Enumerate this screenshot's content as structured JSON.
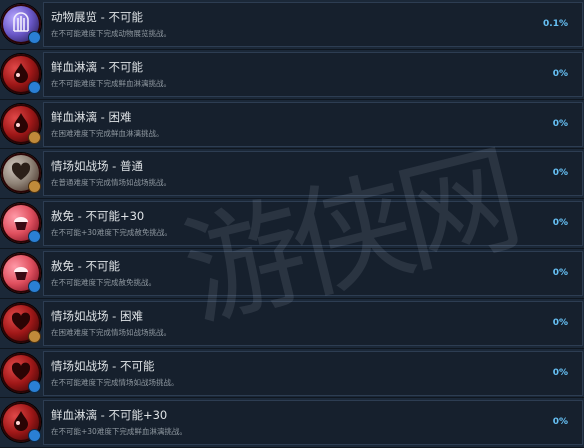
{
  "achievements": [
    {
      "title": "动物展览 - 不可能",
      "desc": "在不可能难度下完成动物展览挑战。",
      "pct": "0.1%",
      "icon": "cage-icon",
      "color": "purple"
    },
    {
      "title": "鲜血淋漓 - 不可能",
      "desc": "在不可能难度下完成鲜血淋漓挑战。",
      "pct": "0%",
      "icon": "blood-icon",
      "color": "red"
    },
    {
      "title": "鲜血淋漓 - 困难",
      "desc": "在困难难度下完成鲜血淋漓挑战。",
      "pct": "0%",
      "icon": "blood-icon",
      "color": "red"
    },
    {
      "title": "情场如战场 - 普通",
      "desc": "在普通难度下完成情场如战场挑战。",
      "pct": "0%",
      "icon": "heart-icon",
      "color": "gray"
    },
    {
      "title": "赦免 - 不可能+30",
      "desc": "在不可能+30难度下完成赦免挑战。",
      "pct": "0%",
      "icon": "cupcake-icon",
      "color": "pink"
    },
    {
      "title": "赦免 - 不可能",
      "desc": "在不可能难度下完成赦免挑战。",
      "pct": "0%",
      "icon": "cupcake-icon",
      "color": "pink"
    },
    {
      "title": "情场如战场 - 困难",
      "desc": "在困难难度下完成情场如战场挑战。",
      "pct": "0%",
      "icon": "heart-icon",
      "color": "red"
    },
    {
      "title": "情场如战场 - 不可能",
      "desc": "在不可能难度下完成情场如战场挑战。",
      "pct": "0%",
      "icon": "heart-icon",
      "color": "red"
    },
    {
      "title": "鲜血淋漓 - 不可能+30",
      "desc": "在不可能+30难度下完成鲜血淋漓挑战。",
      "pct": "0%",
      "icon": "blood-icon",
      "color": "red"
    }
  ],
  "watermark": "游侠网"
}
